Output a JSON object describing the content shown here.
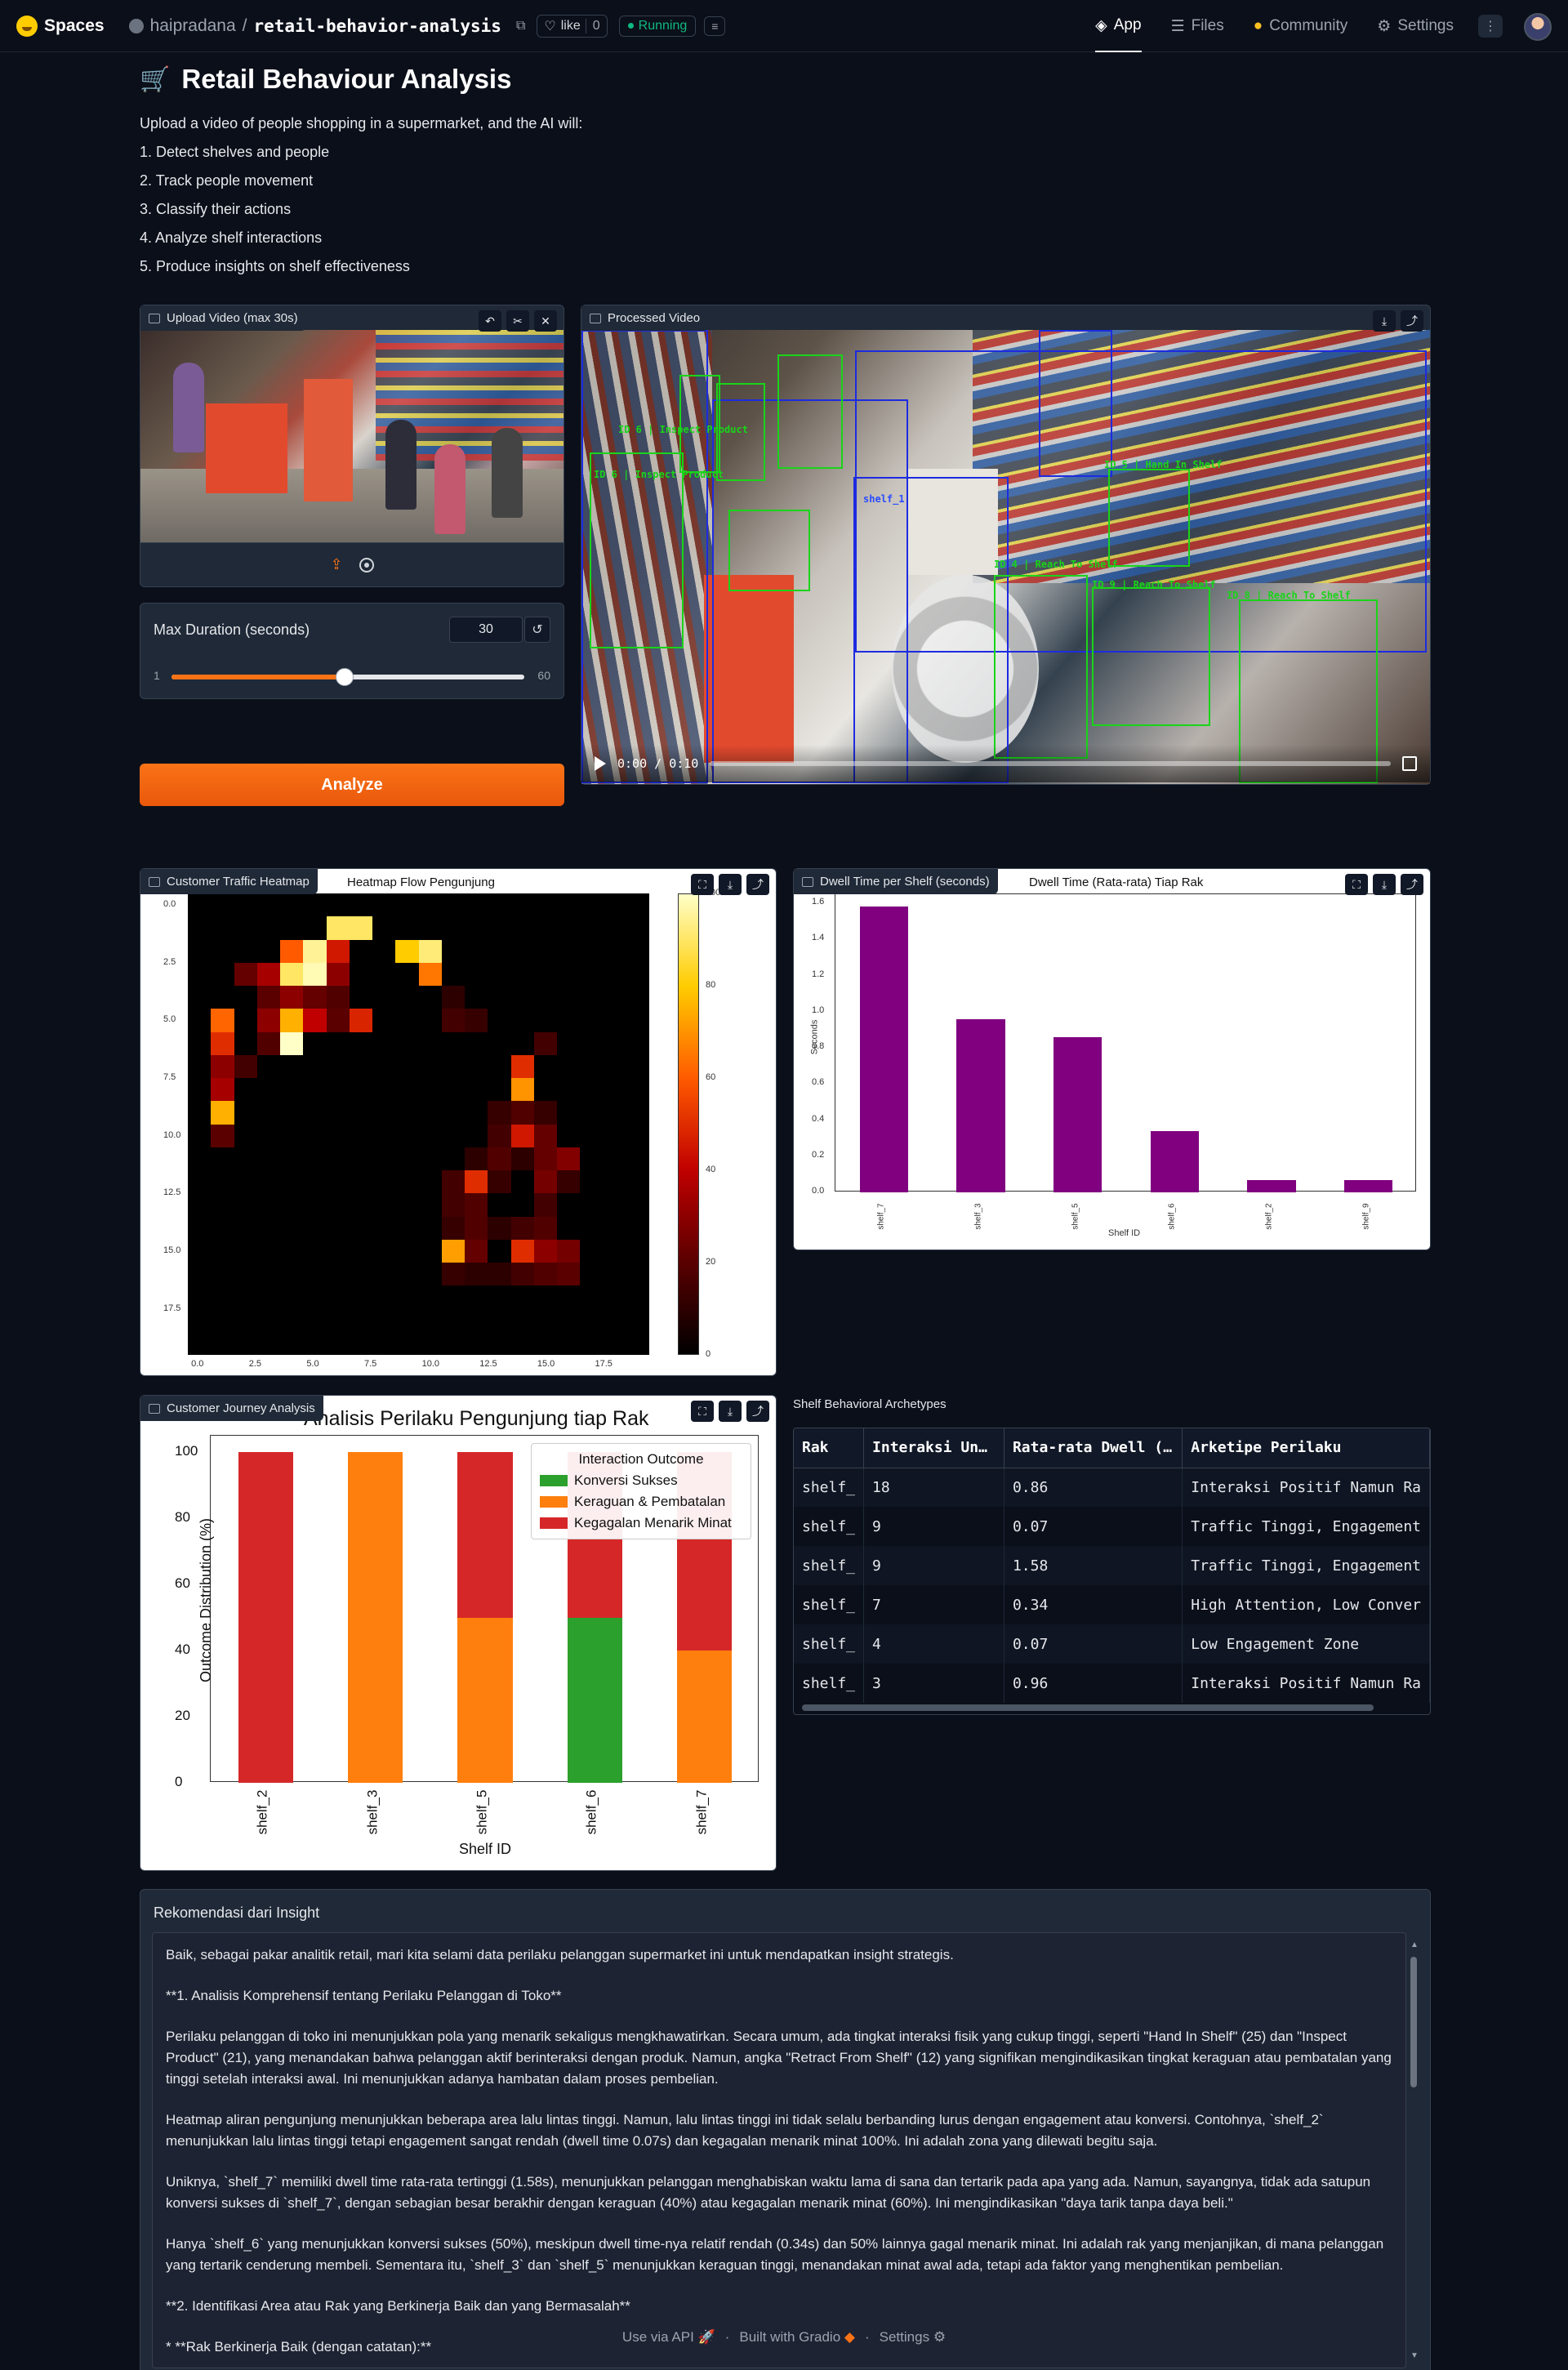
{
  "topbar": {
    "brand": "Spaces",
    "repo_owner": "haipradana",
    "repo_sep": "/",
    "repo_name": "retail-behavior-analysis",
    "like_label": "like",
    "like_count": "0",
    "status": "Running",
    "nav": [
      {
        "label": "App",
        "icon": "cube-icon"
      },
      {
        "label": "Files",
        "icon": "files-icon"
      },
      {
        "label": "Community",
        "icon": "community-icon"
      },
      {
        "label": "Settings",
        "icon": "gear-icon"
      }
    ]
  },
  "app": {
    "title": "Retail Behaviour Analysis",
    "title_icon": "🛒",
    "intro": "Upload a video of people shopping in a supermarket, and the AI will:",
    "steps": [
      "1. Detect shelves and people",
      "2. Track people movement",
      "3. Classify their actions",
      "4. Analyze shelf interactions",
      "5. Produce insights on shelf effectiveness"
    ]
  },
  "upload_video": {
    "label": "Upload Video (max 30s)"
  },
  "slider": {
    "label": "Max Duration (seconds)",
    "value": "30",
    "min": "1",
    "max": "60",
    "fraction": 0.49
  },
  "analyze_button": "Analyze",
  "processed_video": {
    "label": "Processed Video",
    "time": "0:00 / 0:10",
    "labels": [
      "ID 6 | Inspect Product",
      "ID 6 | Inspect Product",
      "ID 9 | Reach To Shelf",
      "ID 8 | Reach To Shelf",
      "ID 4 | Reach To Shelf",
      "ID 5 | Hand In Shelf",
      "shelf_1"
    ]
  },
  "heatmap": {
    "label": "Customer Traffic Heatmap",
    "title": "Heatmap Flow Pengunjung",
    "x_ticks": [
      "0.0",
      "2.5",
      "5.0",
      "7.5",
      "10.0",
      "12.5",
      "15.0",
      "17.5"
    ],
    "y_ticks": [
      "0.0",
      "2.5",
      "5.0",
      "7.5",
      "10.0",
      "12.5",
      "15.0",
      "17.5"
    ],
    "cbar_ticks": [
      "100",
      "80",
      "60",
      "40",
      "20",
      "0"
    ]
  },
  "dwell": {
    "label": "Dwell Time per Shelf (seconds)",
    "title": "Dwell Time (Rata-rata) Tiap Rak",
    "ylabel": "Seconds",
    "xlabel": "Shelf ID",
    "y_ticks": [
      "1.6",
      "1.4",
      "1.2",
      "1.0",
      "0.8",
      "0.6",
      "0.4",
      "0.2",
      "0.0"
    ]
  },
  "journey": {
    "label": "Customer Journey Analysis",
    "title": "Analisis Perilaku Pengunjung tiap Rak",
    "ylabel": "Outcome Distribution (%)",
    "xlabel": "Shelf ID",
    "y_ticks": [
      "100",
      "80",
      "60",
      "40",
      "20",
      "0"
    ],
    "legend_title": "Interaction Outcome",
    "legend": [
      {
        "name": "Konversi Sukses",
        "color": "#2ca02c"
      },
      {
        "name": "Keraguan & Pembatalan",
        "color": "#ff7f0e"
      },
      {
        "name": "Kegagalan Menarik Minat",
        "color": "#d62728"
      }
    ]
  },
  "chart_data": [
    {
      "type": "heatmap",
      "title": "Heatmap Flow Pengunjung",
      "grid_size": [
        20,
        20
      ],
      "cells": [
        {
          "x": 6,
          "y": 1,
          "v": 90
        },
        {
          "x": 7,
          "y": 1,
          "v": 90
        },
        {
          "x": 4,
          "y": 2,
          "v": 60
        },
        {
          "x": 5,
          "y": 2,
          "v": 95
        },
        {
          "x": 6,
          "y": 2,
          "v": 45
        },
        {
          "x": 9,
          "y": 2,
          "v": 80
        },
        {
          "x": 10,
          "y": 2,
          "v": 92
        },
        {
          "x": 2,
          "y": 3,
          "v": 22
        },
        {
          "x": 3,
          "y": 3,
          "v": 35
        },
        {
          "x": 4,
          "y": 3,
          "v": 90
        },
        {
          "x": 5,
          "y": 3,
          "v": 98
        },
        {
          "x": 6,
          "y": 3,
          "v": 30
        },
        {
          "x": 10,
          "y": 3,
          "v": 65
        },
        {
          "x": 3,
          "y": 4,
          "v": 20
        },
        {
          "x": 4,
          "y": 4,
          "v": 30
        },
        {
          "x": 5,
          "y": 4,
          "v": 22
        },
        {
          "x": 6,
          "y": 4,
          "v": 18
        },
        {
          "x": 11,
          "y": 4,
          "v": 10
        },
        {
          "x": 1,
          "y": 5,
          "v": 62
        },
        {
          "x": 3,
          "y": 5,
          "v": 30
        },
        {
          "x": 4,
          "y": 5,
          "v": 75
        },
        {
          "x": 5,
          "y": 5,
          "v": 40
        },
        {
          "x": 6,
          "y": 5,
          "v": 20
        },
        {
          "x": 7,
          "y": 5,
          "v": 48
        },
        {
          "x": 11,
          "y": 5,
          "v": 15
        },
        {
          "x": 12,
          "y": 5,
          "v": 12
        },
        {
          "x": 1,
          "y": 6,
          "v": 50
        },
        {
          "x": 3,
          "y": 6,
          "v": 18
        },
        {
          "x": 4,
          "y": 6,
          "v": 100
        },
        {
          "x": 15,
          "y": 6,
          "v": 15
        },
        {
          "x": 1,
          "y": 7,
          "v": 30
        },
        {
          "x": 2,
          "y": 7,
          "v": 15
        },
        {
          "x": 14,
          "y": 7,
          "v": 50
        },
        {
          "x": 1,
          "y": 8,
          "v": 35
        },
        {
          "x": 14,
          "y": 8,
          "v": 70
        },
        {
          "x": 1,
          "y": 9,
          "v": 75
        },
        {
          "x": 13,
          "y": 9,
          "v": 12
        },
        {
          "x": 14,
          "y": 9,
          "v": 18
        },
        {
          "x": 15,
          "y": 9,
          "v": 12
        },
        {
          "x": 1,
          "y": 10,
          "v": 20
        },
        {
          "x": 13,
          "y": 10,
          "v": 15
        },
        {
          "x": 14,
          "y": 10,
          "v": 45
        },
        {
          "x": 15,
          "y": 10,
          "v": 22
        },
        {
          "x": 12,
          "y": 11,
          "v": 10
        },
        {
          "x": 13,
          "y": 11,
          "v": 18
        },
        {
          "x": 14,
          "y": 11,
          "v": 10
        },
        {
          "x": 15,
          "y": 11,
          "v": 22
        },
        {
          "x": 16,
          "y": 11,
          "v": 28
        },
        {
          "x": 11,
          "y": 12,
          "v": 15
        },
        {
          "x": 12,
          "y": 12,
          "v": 50
        },
        {
          "x": 13,
          "y": 12,
          "v": 12
        },
        {
          "x": 15,
          "y": 12,
          "v": 25
        },
        {
          "x": 16,
          "y": 12,
          "v": 12
        },
        {
          "x": 11,
          "y": 13,
          "v": 15
        },
        {
          "x": 12,
          "y": 13,
          "v": 18
        },
        {
          "x": 15,
          "y": 13,
          "v": 15
        },
        {
          "x": 11,
          "y": 14,
          "v": 12
        },
        {
          "x": 12,
          "y": 14,
          "v": 18
        },
        {
          "x": 13,
          "y": 14,
          "v": 10
        },
        {
          "x": 14,
          "y": 14,
          "v": 15
        },
        {
          "x": 15,
          "y": 14,
          "v": 18
        },
        {
          "x": 11,
          "y": 15,
          "v": 72
        },
        {
          "x": 12,
          "y": 15,
          "v": 22
        },
        {
          "x": 14,
          "y": 15,
          "v": 50
        },
        {
          "x": 15,
          "y": 15,
          "v": 30
        },
        {
          "x": 16,
          "y": 15,
          "v": 25
        },
        {
          "x": 11,
          "y": 16,
          "v": 12
        },
        {
          "x": 12,
          "y": 16,
          "v": 10
        },
        {
          "x": 13,
          "y": 16,
          "v": 10
        },
        {
          "x": 14,
          "y": 16,
          "v": 15
        },
        {
          "x": 15,
          "y": 16,
          "v": 18
        },
        {
          "x": 16,
          "y": 16,
          "v": 20
        }
      ]
    },
    {
      "type": "bar",
      "title": "Dwell Time (Rata-rata) Tiap Rak",
      "xlabel": "Shelf ID",
      "ylabel": "Seconds",
      "ylim": [
        0,
        1.65
      ],
      "categories": [
        "shelf_7",
        "shelf_3",
        "shelf_5",
        "shelf_6",
        "shelf_2",
        "shelf_9"
      ],
      "values": [
        1.58,
        0.96,
        0.86,
        0.34,
        0.07,
        0.07
      ],
      "color": "#800080"
    },
    {
      "type": "bar",
      "stacked": true,
      "title": "Analisis Perilaku Pengunjung tiap Rak",
      "xlabel": "Shelf ID",
      "ylabel": "Outcome Distribution (%)",
      "ylim": [
        0,
        100
      ],
      "categories": [
        "shelf_2",
        "shelf_3",
        "shelf_5",
        "shelf_6",
        "shelf_7"
      ],
      "series": [
        {
          "name": "Konversi Sukses",
          "values": [
            0,
            0,
            0,
            50,
            0
          ]
        },
        {
          "name": "Keraguan & Pembatalan",
          "values": [
            0,
            100,
            50,
            0,
            40
          ]
        },
        {
          "name": "Kegagalan Menarik Minat",
          "values": [
            100,
            0,
            50,
            50,
            60
          ]
        }
      ]
    }
  ],
  "archetypes": {
    "title": "Shelf Behavioral Archetypes",
    "columns": [
      "Rak",
      "Interaksi Un…",
      "Rata-rata Dwell (…",
      "Arketipe Perilaku"
    ],
    "rows": [
      [
        "shelf_",
        "18",
        "0.86",
        "Interaksi Positif Namun Ra"
      ],
      [
        "shelf_",
        "9",
        "0.07",
        "Traffic Tinggi, Engagement"
      ],
      [
        "shelf_",
        "9",
        "1.58",
        "Traffic Tinggi, Engagement"
      ],
      [
        "shelf_",
        "7",
        "0.34",
        "High Attention, Low Conver"
      ],
      [
        "shelf_",
        "4",
        "0.07",
        "Low Engagement Zone"
      ],
      [
        "shelf_",
        "3",
        "0.96",
        "Interaksi Positif Namun Ra"
      ]
    ]
  },
  "insight": {
    "label": "Rekomendasi dari Insight",
    "paragraphs": [
      "Baik, sebagai pakar analitik retail, mari kita selami data perilaku pelanggan supermarket ini untuk mendapatkan insight strategis.",
      "**1. Analisis Komprehensif tentang Perilaku Pelanggan di Toko**",
      "Perilaku pelanggan di toko ini menunjukkan pola yang menarik sekaligus mengkhawatirkan. Secara umum, ada tingkat interaksi fisik yang cukup tinggi, seperti \"Hand In Shelf\" (25) dan \"Inspect Product\" (21), yang menandakan bahwa pelanggan aktif berinteraksi dengan produk. Namun, angka \"Retract From Shelf\" (12) yang signifikan mengindikasikan tingkat keraguan atau pembatalan yang tinggi setelah interaksi awal. Ini menunjukkan adanya hambatan dalam proses pembelian.",
      "Heatmap aliran pengunjung menunjukkan beberapa area lalu lintas tinggi. Namun, lalu lintas tinggi ini tidak selalu berbanding lurus dengan engagement atau konversi. Contohnya, `shelf_2` menunjukkan lalu lintas tinggi tetapi engagement sangat rendah (dwell time 0.07s) dan kegagalan menarik minat 100%. Ini adalah zona yang dilewati begitu saja.",
      "Uniknya, `shelf_7` memiliki dwell time rata-rata tertinggi (1.58s), menunjukkan pelanggan menghabiskan waktu lama di sana dan tertarik pada apa yang ada. Namun, sayangnya, tidak ada satupun konversi sukses di `shelf_7`, dengan sebagian besar berakhir dengan keraguan (40%) atau kegagalan menarik minat (60%). Ini mengindikasikan \"daya tarik tanpa daya beli.\"",
      "Hanya `shelf_6` yang menunjukkan konversi sukses (50%), meskipun dwell time-nya relatif rendah (0.34s) dan 50% lainnya gagal menarik minat. Ini adalah rak yang menjanjikan, di mana pelanggan yang tertarik cenderung membeli. Sementara itu, `shelf_3` dan `shelf_5` menunjukkan keraguan tinggi, menandakan minat awal ada, tetapi ada faktor yang menghentikan pembelian.",
      "**2. Identifikasi Area atau Rak yang Berkinerja Baik dan yang Bermasalah**",
      "*   **Rak Berkinerja Baik (dengan catatan):**"
    ]
  },
  "footer": {
    "api": "Use via API",
    "gradio": "Built with Gradio",
    "settings": "Settings",
    "sep": "·"
  }
}
